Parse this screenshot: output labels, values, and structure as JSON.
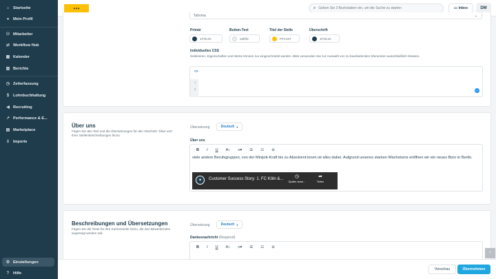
{
  "sidebar": {
    "items": [
      {
        "label": "Startseite",
        "icon": "house-icon"
      },
      {
        "label": "Mein Profil",
        "icon": "user-icon"
      },
      {
        "label": "Mitarbeiter",
        "icon": "users-icon"
      },
      {
        "label": "Workflow Hub",
        "icon": "workflow-icon"
      },
      {
        "label": "Kalender",
        "icon": "calendar-icon"
      },
      {
        "label": "Berichte",
        "icon": "chart-icon"
      },
      {
        "label": "Zeiterfassung",
        "icon": "clock-icon"
      },
      {
        "label": "Lohnbuchhaltung",
        "icon": "dollar-icon"
      },
      {
        "label": "Recruiting",
        "icon": "megaphone-icon"
      },
      {
        "label": "Performance & E...",
        "icon": "trend-icon"
      },
      {
        "label": "Marketplace",
        "icon": "store-icon"
      },
      {
        "label": "Importe",
        "icon": "import-icon"
      }
    ],
    "settings_label": "Einstellungen",
    "help_label": "Hilfe"
  },
  "topbar": {
    "search_placeholder": "Geben Sie 3 Buchstaben ein, um die Suche zu starten",
    "inbox_label": "Inbox",
    "avatar_initials": "DM"
  },
  "design": {
    "font_value": "Tahoma",
    "colors": [
      {
        "label": "Primär",
        "value": "1F3C4C",
        "hex": "#1F3C4C"
      },
      {
        "label": "Button-Text",
        "value": "eaf0f2",
        "hex": "#eaf0f2"
      },
      {
        "label": "Titel der Stelle",
        "value": "FFC107",
        "hex": "#FFC107"
      },
      {
        "label": "Überschrift",
        "value": "1F3C4C",
        "hex": "#1F3C4C"
      }
    ],
    "css_label": "Individuelles CSS",
    "css_hint": "Selektoren, Eigenschaften und Werte können nur eingeschränkt werden. Bitte verwenden Sie zur Auswahl von zu bearbeitenden Elementen ausschließlich Klassen.",
    "code_button": "<>",
    "line_numbers": [
      "1",
      "2"
    ]
  },
  "about": {
    "title": "Über uns",
    "description": "Fügen Sie den Text und die Übersetzungen für den Abschnitt \"Über uns\" Ihrer Stellenbeschreibungen hinzu.",
    "translation_label": "Übersetzung",
    "language": "Deutsch",
    "field_label": "Über uns",
    "body_text": "viele andere Berufsgruppen, von der Minijob-Kraft bis zu Absolvent:innen ist alles dabei. Aufgrund unseres starken Wachstums eröffnen wir ein neues Büro in Berlin.",
    "video_title": "Customer Success Story: 1. FC Köln &...",
    "video_later": "Später anse...",
    "video_share": "Teilen"
  },
  "descriptions": {
    "title": "Beschreibungen und Übersetzungen",
    "description": "Fügen Sie die Texte für Ihre Karriereseite hinzu, die den Bewerbenden angezeigt werden soll.",
    "translation_label": "Übersetzung",
    "language": "Deutsch",
    "field_label": "Dankesnachricht",
    "required_label": "(Required)"
  },
  "footer": {
    "preview_label": "Vorschau",
    "apply_label": "Übernehmen"
  }
}
